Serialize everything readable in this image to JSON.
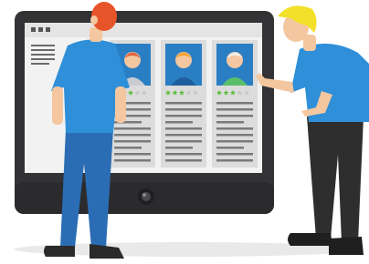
{
  "illustration": {
    "subject": "review-profiles-on-monitor",
    "colors": {
      "monitor_bezel": "#333335",
      "screen_bg": "#f2f2f2",
      "card_bg": "#dcdcdc",
      "photo_bg": "#2a7ec4",
      "star_on": "#5fbf3f",
      "star_off": "#c8c8c8",
      "shirt": "#2f8fd8",
      "pants": "#2a6db5",
      "pants_right": "#2e2e2e",
      "hair_left": "#e8542a",
      "hair_right": "#f2e02a",
      "skin": "#f4c7a0"
    },
    "profiles": [
      {
        "avatar": "woman-avatar",
        "rating": 3,
        "max": 5
      },
      {
        "avatar": "man-avatar",
        "rating": 3,
        "max": 5
      },
      {
        "avatar": "older-man-avatar",
        "rating": 3,
        "max": 5
      }
    ],
    "icons": [
      "window-dots-icon",
      "sidebar-menu-icon",
      "camera-icon",
      "star-icon"
    ]
  }
}
